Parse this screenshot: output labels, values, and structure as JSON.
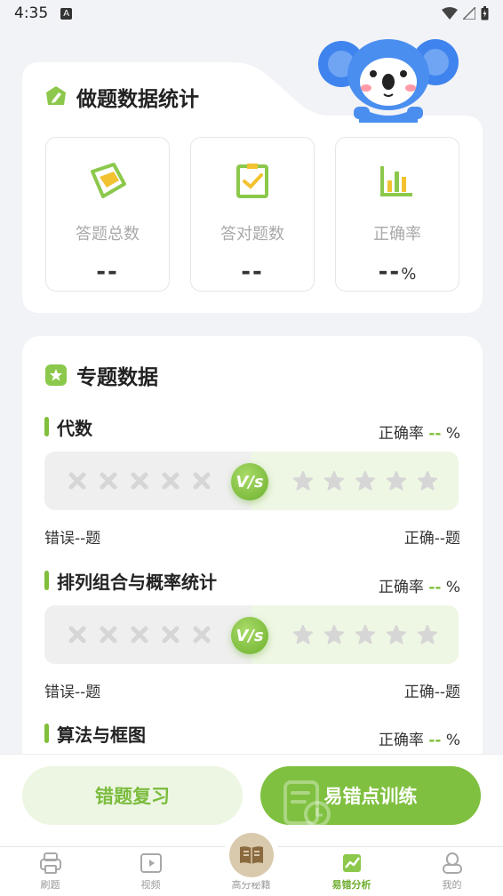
{
  "status_bar": {
    "time": "4:35",
    "notification_icon": "A"
  },
  "stats": {
    "title": "做题数据统计",
    "items": [
      {
        "label": "答题总数",
        "value": "--",
        "unit": "",
        "icon": "notebook-icon"
      },
      {
        "label": "答对题数",
        "value": "--",
        "unit": "",
        "icon": "checklist-icon"
      },
      {
        "label": "正确率",
        "value": "--",
        "unit": "%",
        "icon": "bar-chart-icon"
      }
    ]
  },
  "topics": {
    "title": "专题数据",
    "rate_label": "正确率",
    "vs_label": "V/s",
    "items": [
      {
        "name": "代数",
        "rate": "--",
        "rate_unit": "%",
        "wrong": "错误--题",
        "right": "正确--题"
      },
      {
        "name": "排列组合与概率统计",
        "rate": "--",
        "rate_unit": "%",
        "wrong": "错误--题",
        "right": "正确--题"
      },
      {
        "name": "算法与框图",
        "rate": "--",
        "rate_unit": "%"
      }
    ]
  },
  "actions": {
    "review": "错题复习",
    "train": "易错点训练"
  },
  "tabs": [
    {
      "label": "刷题",
      "icon": "printer-icon",
      "active": false
    },
    {
      "label": "视频",
      "icon": "video-icon",
      "active": false
    },
    {
      "label": "高分秘籍",
      "icon": "book-icon",
      "active": false
    },
    {
      "label": "易错分析",
      "icon": "analysis-icon",
      "active": true
    },
    {
      "label": "我的",
      "icon": "user-icon",
      "active": false
    }
  ],
  "colors": {
    "accent": "#7fc040",
    "accent_dark": "#6eac2f",
    "background": "#f2f3f7"
  }
}
